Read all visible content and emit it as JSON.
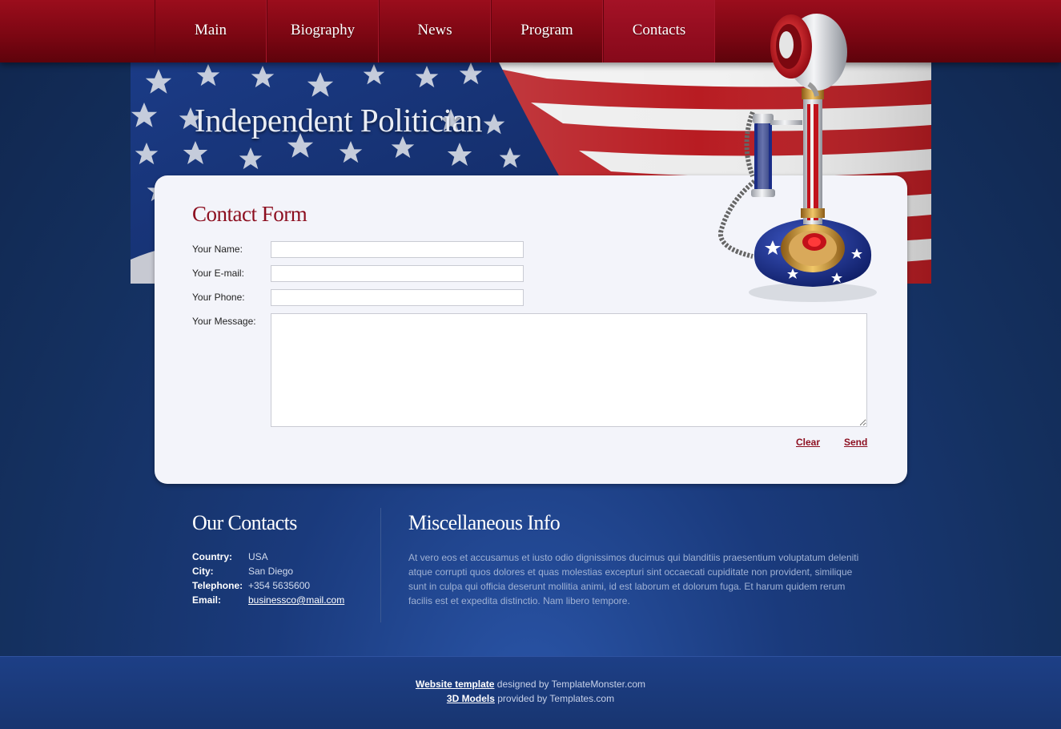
{
  "nav": {
    "items": [
      {
        "label": "Main"
      },
      {
        "label": "Biography"
      },
      {
        "label": "News"
      },
      {
        "label": "Program"
      },
      {
        "label": "Contacts"
      }
    ],
    "active_index": 4
  },
  "header": {
    "title": "Independent Politician"
  },
  "contact_form": {
    "title": "Contact Form",
    "name_label": "Your Name:",
    "email_label": "Your E-mail:",
    "phone_label": "Your Phone:",
    "message_label": "Your Message:",
    "name_value": "",
    "email_value": "",
    "phone_value": "",
    "message_value": "",
    "clear_label": "Clear",
    "send_label": "Send"
  },
  "our_contacts": {
    "title": "Our Contacts",
    "rows": [
      {
        "key": "Country:",
        "value": "USA"
      },
      {
        "key": "City:",
        "value": "San Diego"
      },
      {
        "key": "Telephone:",
        "value": "+354 5635600"
      },
      {
        "key": "Email:",
        "value": "businessco@mail.com"
      }
    ]
  },
  "misc": {
    "title": "Miscellaneous Info",
    "text": "At vero eos et accusamus et iusto odio dignissimos ducimus qui blanditiis praesentium voluptatum deleniti atque corrupti quos dolores et quas molestias excepturi sint occaecati cupiditate non provident, similique sunt in culpa qui officia deserunt mollitia animi, id est laborum et dolorum fuga. Et harum quidem rerum facilis est et expedita distinctio. Nam libero tempore."
  },
  "footer": {
    "line1_link": "Website template",
    "line1_text": " designed by TemplateMonster.com",
    "line2_link": "3D Models",
    "line2_text": " provided by Templates.com"
  },
  "colors": {
    "nav_red": "#8a0816",
    "accent_red": "#8c0e1f",
    "page_blue": "#1a3a7c",
    "panel_bg": "#f3f4fa"
  }
}
